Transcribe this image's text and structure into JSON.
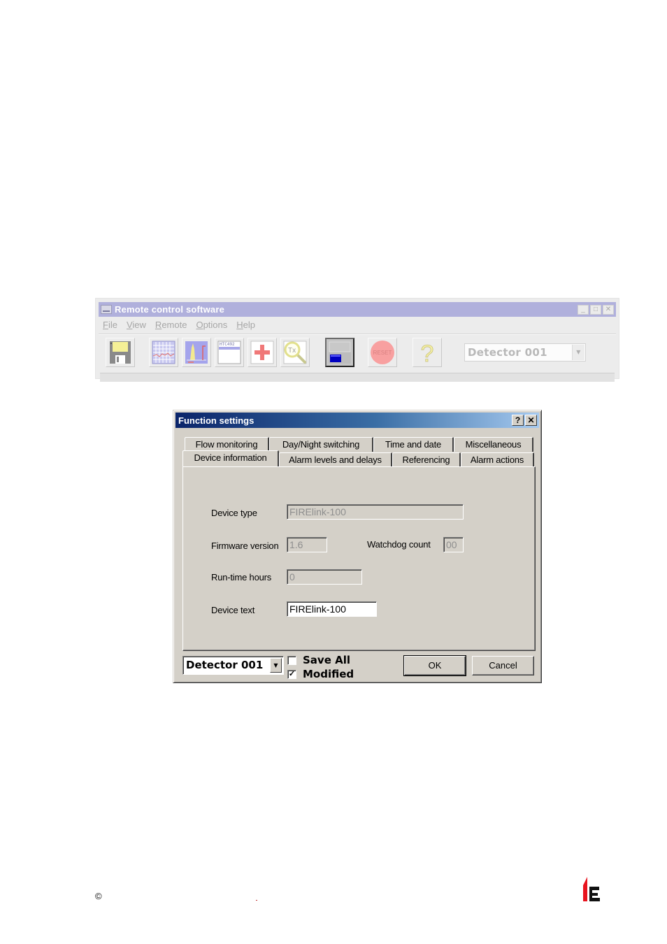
{
  "remote_window": {
    "title": "Remote control software",
    "title_buttons": [
      "minimize",
      "maximize",
      "close"
    ],
    "menu": [
      {
        "label": "File",
        "accel": "F"
      },
      {
        "label": "View",
        "accel": "V"
      },
      {
        "label": "Remote",
        "accel": "R"
      },
      {
        "label": "Options",
        "accel": "O"
      },
      {
        "label": "Help",
        "accel": "H"
      }
    ],
    "toolbar": [
      {
        "name": "save-icon"
      },
      {
        "name": "trend-graph-icon"
      },
      {
        "name": "histogram-icon"
      },
      {
        "name": "event-log-icon",
        "text": "HTC492"
      },
      {
        "name": "add-icon"
      },
      {
        "name": "tx-search-icon",
        "text": "Tx"
      },
      {
        "name": "display-window-icon",
        "pressed": true
      },
      {
        "name": "reset-icon",
        "text": "RESET"
      },
      {
        "name": "help-icon",
        "text": "?"
      }
    ],
    "device_select": "Detector 001"
  },
  "dialog": {
    "title": "Function settings",
    "help_button": "?",
    "close_button": "✕",
    "tabs_row_back": [
      "Flow monitoring",
      "Day/Night switching",
      "Time and date",
      "Miscellaneous"
    ],
    "tabs_row_front": [
      "Device information",
      "Alarm levels and delays",
      "Referencing",
      "Alarm actions"
    ],
    "active_tab": "Device information",
    "fields": {
      "device_type": {
        "label": "Device type",
        "value": "FIRElink-100",
        "enabled": false
      },
      "firmware_version": {
        "label": "Firmware version",
        "value": "1.6",
        "enabled": false
      },
      "watchdog_count": {
        "label": "Watchdog count",
        "value": "00",
        "enabled": false
      },
      "runtime_hours": {
        "label": "Run-time hours",
        "value": "0",
        "enabled": false
      },
      "device_text": {
        "label": "Device text",
        "value": "FIRElink-100",
        "enabled": true
      }
    },
    "bottom": {
      "device_select": "Detector 001",
      "save_all": {
        "label": "Save All",
        "checked": false
      },
      "modified": {
        "label": "Modified",
        "checked": true
      },
      "ok_label": "OK",
      "cancel_label": "Cancel"
    }
  },
  "footer": {
    "copyright_symbol": "©"
  },
  "colors": {
    "dialog_face": "#d4d0c8",
    "titlebar_start": "#0a246a",
    "titlebar_end": "#a6caf0",
    "logo_red": "#e8141e",
    "logo_black": "#111111"
  }
}
